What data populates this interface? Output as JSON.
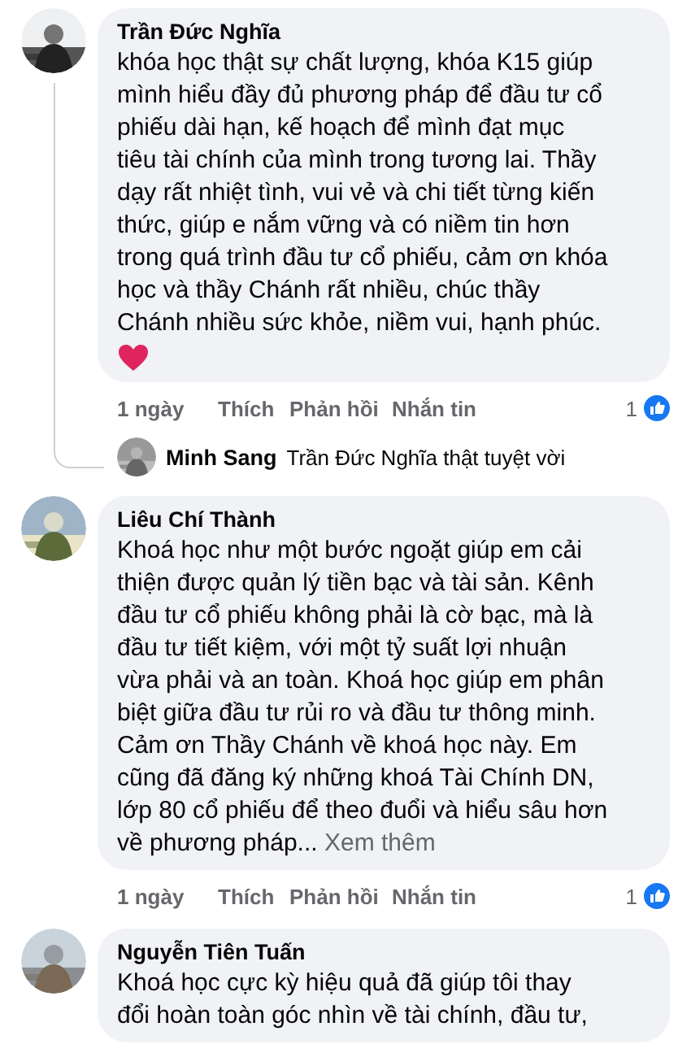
{
  "comments": [
    {
      "author": "Trần Đức Nghĩa",
      "text": "khóa học thật sự chất lượng, khóa K15 giúp\nmình hiểu đầy đủ phương pháp để đầu tư cổ\nphiếu dài hạn, kế hoạch để mình đạt mục\ntiêu tài chính của mình trong tương lai. Thầy\ndạy rất nhiệt tình, vui vẻ và chi tiết từng kiến\nthức, giúp e nắm vững và có niềm tin hơn\ntrong quá trình đầu tư cổ phiếu, cảm ơn khóa\nhọc và thầy Chánh rất nhiều, chúc thầy\nChánh nhiều sức khỏe, niềm vui, hạnh phúc.",
      "heart": true,
      "actions": [
        "1 ngày",
        "Thích",
        "Phản hồi",
        "Nhắn tin"
      ],
      "like_count": "1",
      "reply": {
        "author": "Minh Sang",
        "text": "Trần Đức Nghĩa thật tuyệt vời"
      }
    },
    {
      "author": "Liêu Chí Thành",
      "text": "Khoá học như một bước ngoặt giúp em cải\nthiện được quản lý tiền bạc và tài sản. Kênh\nđầu tư cổ phiếu không phải là cờ bạc, mà là\nđầu tư tiết kiệm, với một tỷ suất lợi nhuận\nvừa phải và an toàn. Khoá học giúp em phân\nbiệt giữa đầu tư rủi ro và đầu tư thông minh.\nCảm ơn Thầy Chánh về khoá học này. Em\ncũng đã đăng ký những khoá Tài Chính DN,\nlớp 80 cổ phiếu để theo đuổi và hiểu sâu hơn\nvề phương pháp...",
      "see_more": "Xem thêm",
      "actions": [
        "1 ngày",
        "Thích",
        "Phản hồi",
        "Nhắn tin"
      ],
      "like_count": "1"
    },
    {
      "author": "Nguyễn Tiên Tuấn",
      "text": "Khoá học cực kỳ hiệu quả đã giúp tôi thay\nđổi hoàn toàn góc nhìn về tài chính, đầu tư,"
    }
  ]
}
